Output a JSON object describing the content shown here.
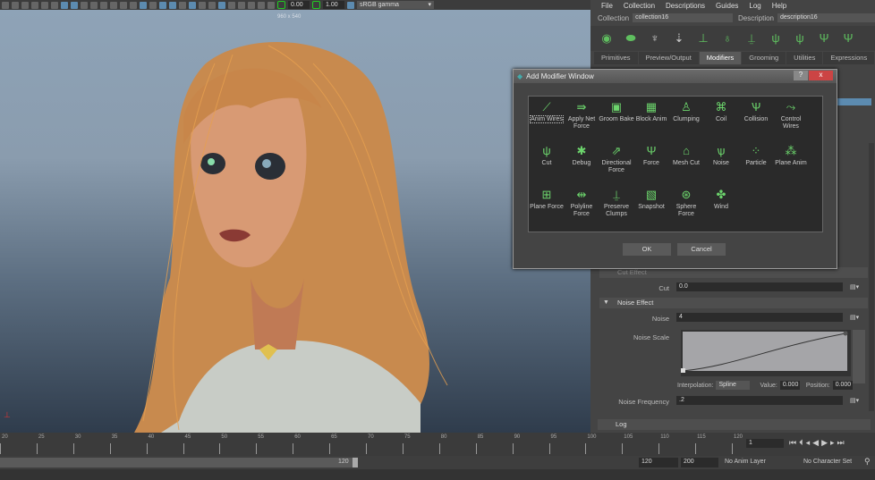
{
  "toolbar": {
    "exposure": "0.00",
    "gamma_value": "1.00",
    "color_space": "sRGB gamma"
  },
  "viewport": {
    "resolution": "960 x 540"
  },
  "menu": [
    "File",
    "Collection",
    "Descriptions",
    "Guides",
    "Log",
    "Help"
  ],
  "collection": {
    "label": "Collection",
    "value": "collection16"
  },
  "description": {
    "label": "Description",
    "value": "description16"
  },
  "tabs": [
    {
      "label": "Primitives"
    },
    {
      "label": "Preview/Output"
    },
    {
      "label": "Modifiers",
      "active": true
    },
    {
      "label": "Grooming"
    },
    {
      "label": "Utilities"
    },
    {
      "label": "Expressions"
    }
  ],
  "dialog": {
    "title": "Add Modifier Window",
    "help": "?",
    "close": "x",
    "ok": "OK",
    "cancel": "Cancel",
    "modifiers": [
      "Anim Wires",
      "Apply Net Force",
      "Groom Bake",
      "Block Anim",
      "Clumping",
      "Coil",
      "Collision",
      "Control Wires",
      "Cut",
      "Debug",
      "Directional Force",
      "Force",
      "Mesh Cut",
      "Noise",
      "Particle",
      "Plane Anim",
      "Plane Force",
      "Polyline Force",
      "Preserve Clumps",
      "Snapshot",
      "Sphere Force",
      "Wind"
    ]
  },
  "attrs": {
    "cut_effect": "Cut Effect",
    "cut_label": "Cut",
    "cut_value": "0.0",
    "noise_effect": "Noise Effect",
    "noise_label": "Noise",
    "noise_value": "4",
    "noise_scale": "Noise Scale",
    "interp_label": "Interpolation:",
    "interp_value": "Spline",
    "value_label": "Value:",
    "value": "0.000",
    "position_label": "Position:",
    "position": "0.000",
    "freq_label": "Noise Frequency",
    "freq_value": ".2",
    "log": "Log"
  },
  "timeline": {
    "ticks": [
      "20",
      "25",
      "30",
      "35",
      "40",
      "45",
      "50",
      "55",
      "60",
      "65",
      "70",
      "75",
      "80",
      "85",
      "90",
      "95",
      "100",
      "105",
      "110",
      "115",
      "120"
    ],
    "current_frame": "1"
  },
  "range": {
    "end_marker": "120",
    "end": "120",
    "max": "200",
    "anim_layer": "No Anim Layer",
    "char_set": "No Character Set"
  },
  "colors": {
    "accent": "#5fbf5f",
    "selected": "#5c8bb0"
  }
}
